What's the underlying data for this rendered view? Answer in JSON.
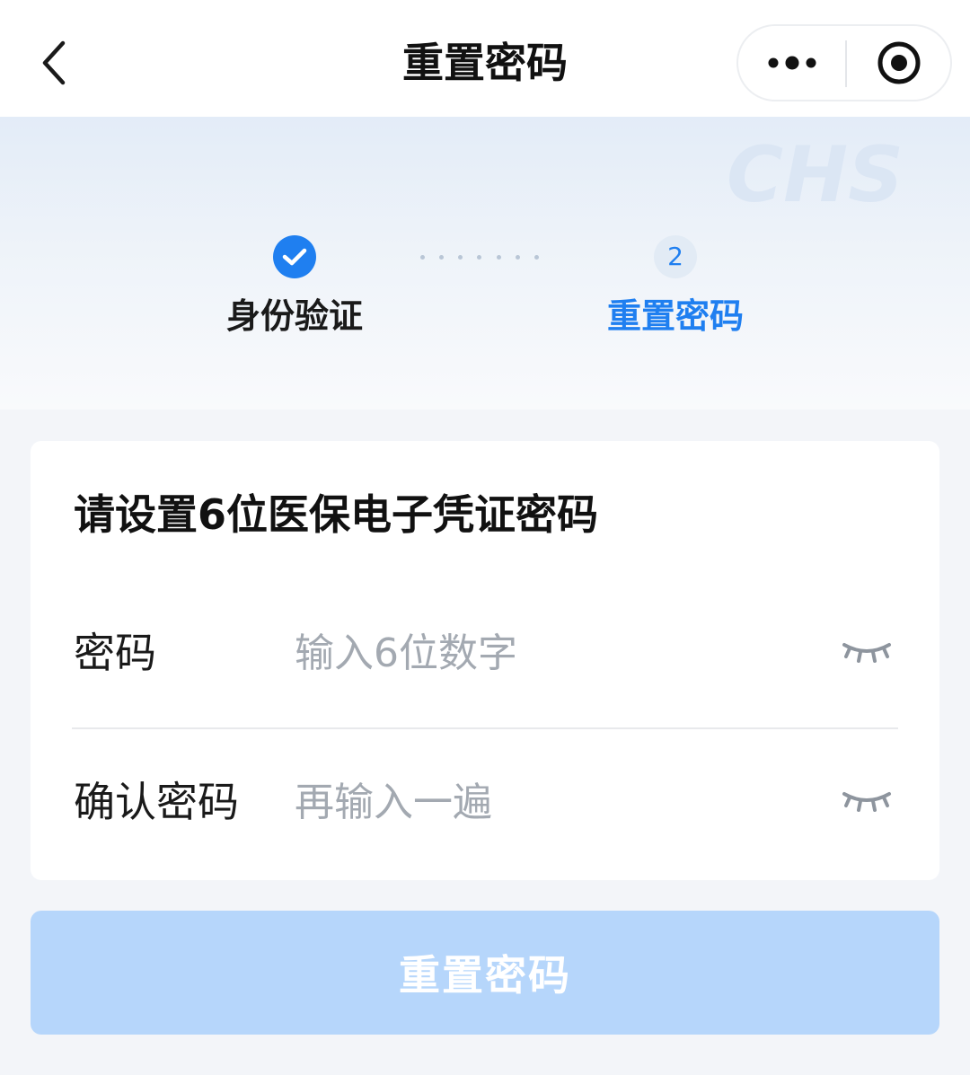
{
  "navbar": {
    "title": "重置密码"
  },
  "banner": {
    "logo_text": "CHS"
  },
  "steps": [
    {
      "label": "身份验证",
      "status": "completed"
    },
    {
      "number": "2",
      "label": "重置密码",
      "status": "active"
    }
  ],
  "form": {
    "title": "请设置6位医保电子凭证密码",
    "password": {
      "label": "密码",
      "value": "",
      "placeholder": "输入6位数字"
    },
    "confirm": {
      "label": "确认密码",
      "value": "",
      "placeholder": "再输入一遍"
    }
  },
  "submit_label": "重置密码",
  "icons": {
    "back": "chevron-left-icon",
    "more": "more-dots-icon",
    "close": "target-circle-icon",
    "step_done": "check-circle-icon",
    "password_toggle": "eye-closed-icon"
  },
  "colors": {
    "accent": "#1f7ff0",
    "button_disabled": "#b6d6fb",
    "placeholder": "#a3a9b1",
    "page_bg": "#f3f5f9"
  }
}
